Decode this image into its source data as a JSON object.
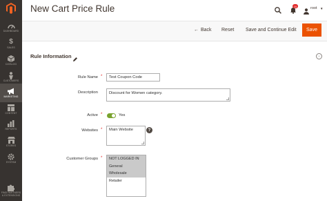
{
  "window": {
    "title": "New Cart Price Rule"
  },
  "header": {
    "notification_count": "10",
    "user_name": "root"
  },
  "sidebar": {
    "items": [
      {
        "label": "DASHBOARD",
        "icon": "dashboard-icon"
      },
      {
        "label": "SALES",
        "icon": "dollar-icon"
      },
      {
        "label": "CATALOG",
        "icon": "cube-icon"
      },
      {
        "label": "CUSTOMERS",
        "icon": "person-icon"
      },
      {
        "label": "MARKETING",
        "icon": "megaphone-icon"
      },
      {
        "label": "CONTENT",
        "icon": "layout-icon"
      },
      {
        "label": "REPORTS",
        "icon": "bar-chart-icon"
      },
      {
        "label": "STORES",
        "icon": "storefront-icon"
      },
      {
        "label": "SYSTEM",
        "icon": "gear-icon"
      },
      {
        "label": "FIND PARTNERS & EXTENSIONS",
        "icon": "puzzle-icon"
      }
    ],
    "active": "MARKETING"
  },
  "actions": {
    "back": "Back",
    "reset": "Reset",
    "save_continue": "Save and Continue Edit",
    "save": "Save"
  },
  "section": {
    "title": "Rule Information"
  },
  "form": {
    "rule_name": {
      "label": "Rule Name",
      "value": "Test Coupon Code"
    },
    "description": {
      "label": "Description",
      "value": "Discount for Women category."
    },
    "active": {
      "label": "Active",
      "value": "Yes"
    },
    "websites": {
      "label": "Websites",
      "options": [
        "Main Website"
      ],
      "help": "?"
    },
    "customer_groups": {
      "label": "Customer Groups",
      "options": [
        "NOT LOGGED IN",
        "General",
        "Wholesale",
        "Retailer"
      ],
      "selected": [
        true,
        true,
        true,
        false
      ]
    }
  },
  "colors": {
    "sidebar": "#373330",
    "accent": "#eb5202",
    "toggle_on": "#79a22e"
  }
}
